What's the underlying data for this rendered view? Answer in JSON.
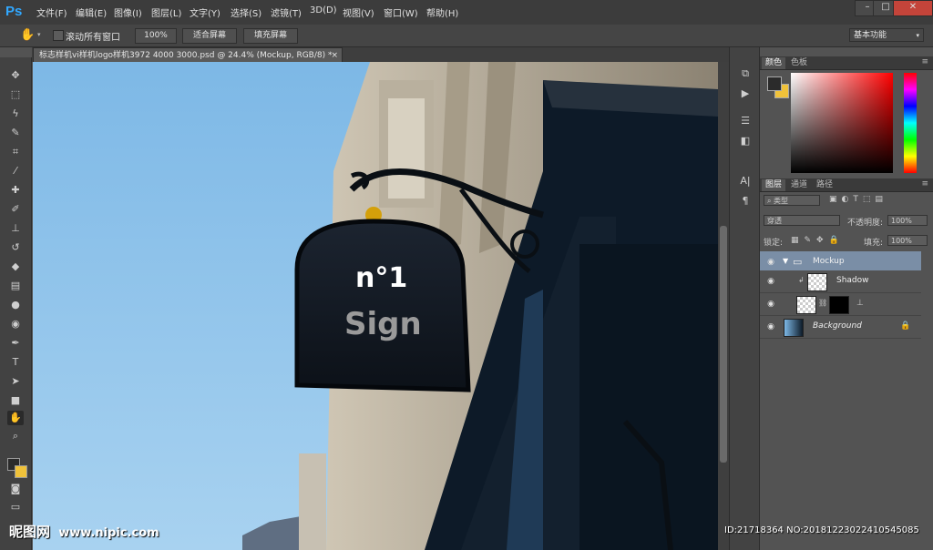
{
  "app": {
    "logo": "Ps"
  },
  "menu": [
    "文件(F)",
    "编辑(E)",
    "图像(I)",
    "图层(L)",
    "文字(Y)",
    "选择(S)",
    "滤镜(T)",
    "3D(D)",
    "视图(V)",
    "窗口(W)",
    "帮助(H)"
  ],
  "window_controls": {
    "minimize": "–",
    "maximize": "□",
    "close": "✕"
  },
  "options": {
    "scroll_all_label": "滚动所有窗口",
    "zoom_100": "100%",
    "fit_screen": "适合屏幕",
    "fill_screen": "填充屏幕",
    "workspace": "基本功能"
  },
  "document": {
    "tab_title": "标志样机vi样机logo样机3972 4000 3000.psd @ 24.4% (Mockup, RGB/8) *",
    "close": "×"
  },
  "canvas": {
    "sign_line1": "n°1",
    "sign_line2": "Sign"
  },
  "color_panel": {
    "tab_color": "颜色",
    "tab_swatches": "色板",
    "foreground": "#2b2b2b",
    "background": "#f0c23a"
  },
  "layers_panel": {
    "tab_layers": "图层",
    "tab_channels": "通道",
    "tab_paths": "路径",
    "filter_kind": "类型",
    "blend_mode": "穿透",
    "opacity_label": "不透明度:",
    "opacity_value": "100%",
    "lock_label": "锁定:",
    "fill_label": "填充:",
    "fill_value": "100%",
    "layers": [
      {
        "name": "Mockup"
      },
      {
        "name": "Shadow"
      },
      {
        "name": ""
      },
      {
        "name": "Background"
      }
    ]
  },
  "watermark": {
    "brand": "昵图网",
    "url": "www.nipic.com"
  },
  "id_line": "ID:21718364 NO:20181223022410545085",
  "icons": [
    "hand-icon",
    "move-icon",
    "marquee-icon",
    "lasso-icon",
    "quick-select-icon",
    "crop-icon",
    "eyedropper-icon",
    "healing-icon",
    "brush-icon",
    "stamp-icon",
    "history-brush-icon",
    "eraser-icon",
    "gradient-icon",
    "blur-icon",
    "dodge-icon",
    "pen-icon",
    "type-icon",
    "path-select-icon",
    "shape-icon",
    "zoom-icon",
    "eye-icon",
    "folder-icon",
    "lock-icon"
  ]
}
